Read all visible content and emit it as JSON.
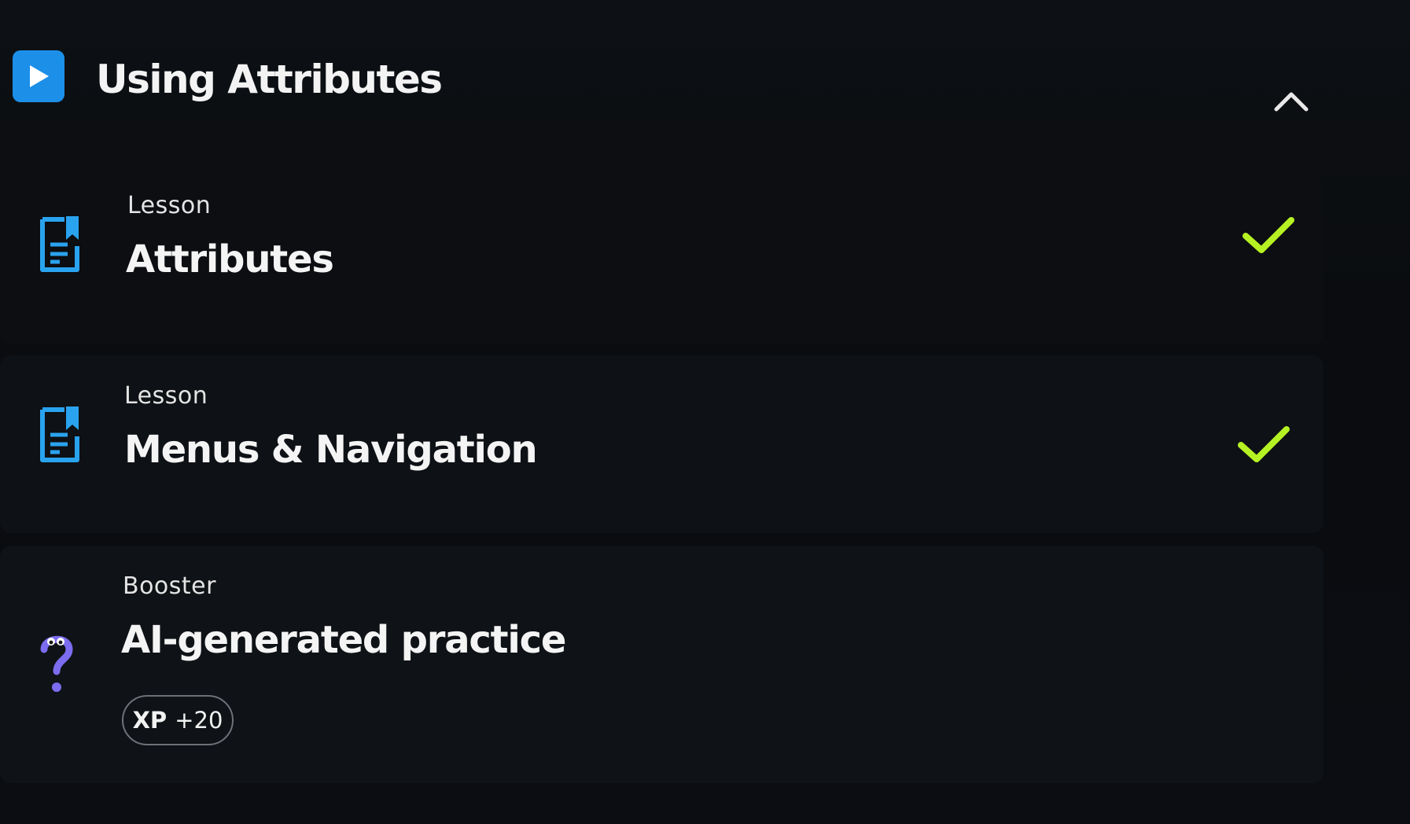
{
  "section": {
    "title": "Using Attributes",
    "icon": "play-icon",
    "collapse_icon": "chevron-up-icon",
    "accent_color": "#1c8fe8"
  },
  "items": [
    {
      "type": "Lesson",
      "title": "Attributes",
      "icon": "lesson-document-icon",
      "status_icon": "checkmark-icon",
      "completed": true
    },
    {
      "type": "Lesson",
      "title": "Menus & Navigation",
      "icon": "lesson-document-icon",
      "status_icon": "checkmark-icon",
      "completed": true
    },
    {
      "type": "Booster",
      "title": "AI-generated practice",
      "icon": "question-mark-character-icon",
      "badge": {
        "label": "XP",
        "value": "+20"
      }
    }
  ],
  "colors": {
    "lesson_icon": "#2aa3ef",
    "check": "#b6f223",
    "booster_icon": "#7c6cf0"
  }
}
